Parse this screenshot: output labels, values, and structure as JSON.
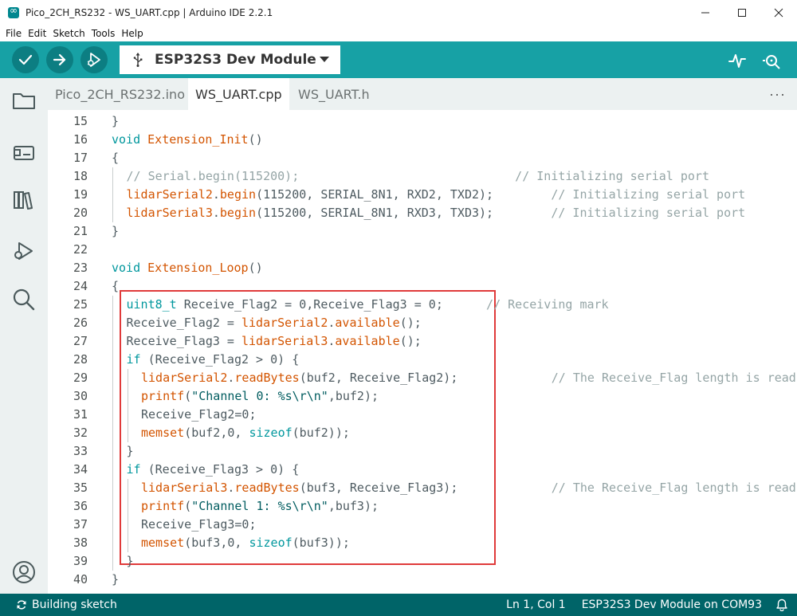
{
  "window": {
    "title": "Pico_2CH_RS232 - WS_UART.cpp | Arduino IDE 2.2.1"
  },
  "menu": [
    "File",
    "Edit",
    "Sketch",
    "Tools",
    "Help"
  ],
  "toolbar": {
    "board": "ESP32S3 Dev Module"
  },
  "tabs": [
    {
      "label": "Pico_2CH_RS232.ino",
      "active": false
    },
    {
      "label": "WS_UART.cpp",
      "active": true
    },
    {
      "label": "WS_UART.h",
      "active": false
    }
  ],
  "tabs_more": "···",
  "code_lines": [
    {
      "n": "15",
      "indent": 0,
      "tokens": [
        [
          "tx",
          "}"
        ]
      ]
    },
    {
      "n": "16",
      "indent": 0,
      "tokens": [
        [
          "kw",
          "void"
        ],
        [
          "tx",
          " "
        ],
        [
          "fn",
          "Extension_Init"
        ],
        [
          "tx",
          "()"
        ]
      ]
    },
    {
      "n": "17",
      "indent": 0,
      "tokens": [
        [
          "tx",
          "{"
        ]
      ]
    },
    {
      "n": "18",
      "indent": 1,
      "tokens": [
        [
          "cm",
          "// Serial.begin(115200);                              // Initializing serial port"
        ]
      ]
    },
    {
      "n": "19",
      "indent": 1,
      "tokens": [
        [
          "fn",
          "lidarSerial2"
        ],
        [
          "tx",
          "."
        ],
        [
          "fn",
          "begin"
        ],
        [
          "tx",
          "(115200, SERIAL_8N1, RXD2, TXD2);        "
        ],
        [
          "cm",
          "// Initializing serial port"
        ]
      ]
    },
    {
      "n": "20",
      "indent": 1,
      "tokens": [
        [
          "fn",
          "lidarSerial3"
        ],
        [
          "tx",
          "."
        ],
        [
          "fn",
          "begin"
        ],
        [
          "tx",
          "(115200, SERIAL_8N1, RXD3, TXD3);        "
        ],
        [
          "cm",
          "// Initializing serial port"
        ]
      ]
    },
    {
      "n": "21",
      "indent": 0,
      "tokens": [
        [
          "tx",
          "}"
        ]
      ]
    },
    {
      "n": "22",
      "indent": 0,
      "tokens": []
    },
    {
      "n": "23",
      "indent": 0,
      "tokens": [
        [
          "kw",
          "void"
        ],
        [
          "tx",
          " "
        ],
        [
          "fn",
          "Extension_Loop"
        ],
        [
          "tx",
          "()"
        ]
      ]
    },
    {
      "n": "24",
      "indent": 0,
      "tokens": [
        [
          "tx",
          "{"
        ]
      ]
    },
    {
      "n": "25",
      "indent": 1,
      "tokens": [
        [
          "kw",
          "uint8_t"
        ],
        [
          "tx",
          " Receive_Flag2 = 0,Receive_Flag3 = 0;      "
        ],
        [
          "cm",
          "// Receiving mark"
        ]
      ]
    },
    {
      "n": "26",
      "indent": 1,
      "tokens": [
        [
          "tx",
          "Receive_Flag2 = "
        ],
        [
          "fn",
          "lidarSerial2"
        ],
        [
          "tx",
          "."
        ],
        [
          "fn",
          "available"
        ],
        [
          "tx",
          "();"
        ]
      ]
    },
    {
      "n": "27",
      "indent": 1,
      "tokens": [
        [
          "tx",
          "Receive_Flag3 = "
        ],
        [
          "fn",
          "lidarSerial3"
        ],
        [
          "tx",
          "."
        ],
        [
          "fn",
          "available"
        ],
        [
          "tx",
          "();"
        ]
      ]
    },
    {
      "n": "28",
      "indent": 1,
      "tokens": [
        [
          "kw",
          "if"
        ],
        [
          "tx",
          " (Receive_Flag2 > 0) {"
        ]
      ]
    },
    {
      "n": "29",
      "indent": 2,
      "tokens": [
        [
          "fn",
          "lidarSerial2"
        ],
        [
          "tx",
          "."
        ],
        [
          "fn",
          "readBytes"
        ],
        [
          "tx",
          "(buf2, Receive_Flag2);             "
        ],
        [
          "cm",
          "// The Receive_Flag length is read"
        ]
      ]
    },
    {
      "n": "30",
      "indent": 2,
      "tokens": [
        [
          "fn",
          "printf"
        ],
        [
          "tx",
          "("
        ],
        [
          "st",
          "\"Channel 0: %s\\r\\n\""
        ],
        [
          "tx",
          ",buf2);"
        ]
      ]
    },
    {
      "n": "31",
      "indent": 2,
      "tokens": [
        [
          "tx",
          "Receive_Flag2=0;"
        ]
      ]
    },
    {
      "n": "32",
      "indent": 2,
      "tokens": [
        [
          "fn",
          "memset"
        ],
        [
          "tx",
          "(buf2,0, "
        ],
        [
          "kw",
          "sizeof"
        ],
        [
          "tx",
          "(buf2));"
        ]
      ]
    },
    {
      "n": "33",
      "indent": 1,
      "tokens": [
        [
          "tx",
          "}"
        ]
      ]
    },
    {
      "n": "34",
      "indent": 1,
      "tokens": [
        [
          "kw",
          "if"
        ],
        [
          "tx",
          " (Receive_Flag3 > 0) {"
        ]
      ]
    },
    {
      "n": "35",
      "indent": 2,
      "tokens": [
        [
          "fn",
          "lidarSerial3"
        ],
        [
          "tx",
          "."
        ],
        [
          "fn",
          "readBytes"
        ],
        [
          "tx",
          "(buf3, Receive_Flag3);             "
        ],
        [
          "cm",
          "// The Receive_Flag length is read"
        ]
      ]
    },
    {
      "n": "36",
      "indent": 2,
      "tokens": [
        [
          "fn",
          "printf"
        ],
        [
          "tx",
          "("
        ],
        [
          "st",
          "\"Channel 1: %s\\r\\n\""
        ],
        [
          "tx",
          ",buf3);"
        ]
      ]
    },
    {
      "n": "37",
      "indent": 2,
      "tokens": [
        [
          "tx",
          "Receive_Flag3=0;"
        ]
      ]
    },
    {
      "n": "38",
      "indent": 2,
      "tokens": [
        [
          "fn",
          "memset"
        ],
        [
          "tx",
          "(buf3,0, "
        ],
        [
          "kw",
          "sizeof"
        ],
        [
          "tx",
          "(buf3));"
        ]
      ]
    },
    {
      "n": "39",
      "indent": 1,
      "tokens": [
        [
          "tx",
          "}"
        ]
      ]
    },
    {
      "n": "40",
      "indent": 0,
      "tokens": [
        [
          "tx",
          "}"
        ]
      ]
    }
  ],
  "status": {
    "left": "Building sketch",
    "position": "Ln 1, Col 1",
    "board_port": "ESP32S3 Dev Module on COM93"
  },
  "colors": {
    "toolbar": "#17a1a5",
    "toolbar_button": "#0c7e82",
    "statusbar": "#006468",
    "sidebar": "#ecf1f1",
    "highlight": "#e03a3a",
    "keyword": "#00979d",
    "function": "#d35400",
    "comment": "#95a5a6"
  }
}
